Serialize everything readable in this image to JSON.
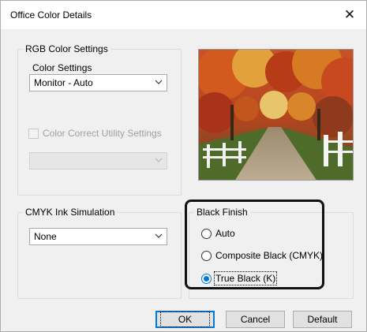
{
  "dialog": {
    "title": "Office Color Details",
    "close_glyph": "✕"
  },
  "rgb": {
    "group_label": "RGB Color Settings",
    "color_settings_label": "Color Settings",
    "color_settings_value": "Monitor - Auto",
    "utility_checkbox_label": "Color Correct Utility Settings",
    "utility_checked": false,
    "utility_dropdown_value": ""
  },
  "preview": {
    "description_icon": "landscape-photo"
  },
  "cmyk": {
    "group_label": "CMYK Ink Simulation",
    "value": "None"
  },
  "black_finish": {
    "group_label": "Black Finish",
    "options": [
      {
        "label": "Auto",
        "checked": false
      },
      {
        "label": "Composite Black (CMYK)",
        "checked": false
      },
      {
        "label": "True Black (K)",
        "checked": true
      }
    ]
  },
  "buttons": {
    "ok": "OK",
    "cancel": "Cancel",
    "default": "Default"
  },
  "colors": {
    "accent": "#0078d7",
    "dialog_bg": "#f0f0f0"
  }
}
